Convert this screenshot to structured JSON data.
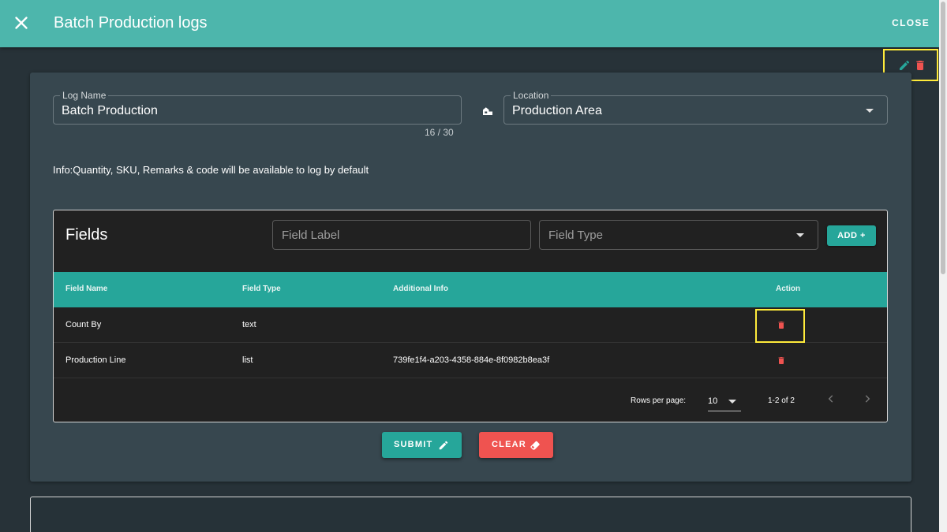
{
  "header": {
    "title": "Batch Production logs",
    "close_label": "CLOSE",
    "bg_color": "#4db6ac"
  },
  "top_actions": {
    "icons": [
      "pencil-icon",
      "trash-icon"
    ],
    "edit_color": "#26a69a",
    "delete_color": "#ef5350"
  },
  "form": {
    "log_name": {
      "label": "Log Name",
      "value": "Batch Production",
      "counter": "16 / 30"
    },
    "location": {
      "label": "Location",
      "value": "Production Area",
      "icon": "location-icon"
    },
    "info_text": "Info:Quantity, SKU, Remarks & code will be available to log by default"
  },
  "fields_panel": {
    "title": "Fields",
    "field_label_placeholder": "Field Label",
    "field_type_placeholder": "Field Type",
    "add_label": "ADD +",
    "columns": [
      "Field Name",
      "Field Type",
      "Additional Info",
      "Action"
    ],
    "rows": [
      {
        "field_name": "Count By",
        "field_type": "text",
        "additional_info": ""
      },
      {
        "field_name": "Production Line",
        "field_type": "list",
        "additional_info": "739fe1f4-a203-4358-884e-8f0982b8ea3f"
      }
    ],
    "pagination": {
      "rows_per_page_label": "Rows per page:",
      "rows_per_page_value": "10",
      "range_label": "1-2 of 2"
    }
  },
  "buttons": {
    "submit_label": "SUBMIT",
    "clear_label": "CLEAR"
  },
  "colors": {
    "accent": "#26a69a",
    "danger": "#ef5350",
    "highlight": "#ffeb3b"
  }
}
